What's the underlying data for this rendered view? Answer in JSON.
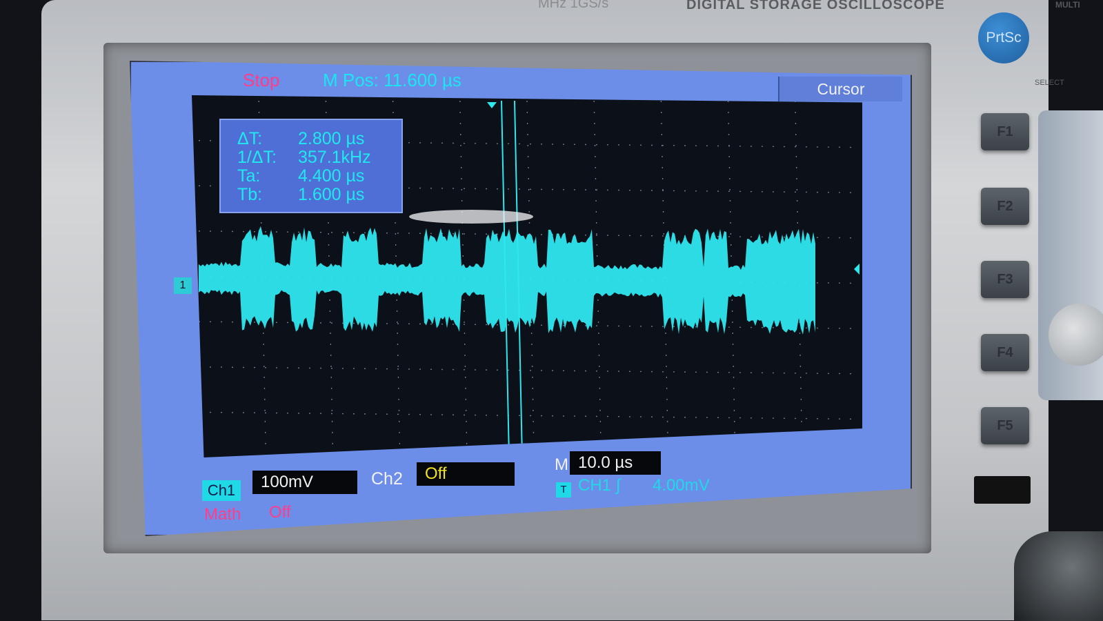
{
  "device": {
    "brand_label": "DIGITAL STORAGE OSCILLOSCOPE",
    "brand_partial": "MHz 1GS/s",
    "select_label": "SELECT",
    "multi_label": "MULTI",
    "prtsc_label": "PrtSc",
    "function_buttons": [
      "F1",
      "F2",
      "F3",
      "F4",
      "F5"
    ]
  },
  "screen": {
    "run_state": "Stop",
    "m_pos": "M Pos: 11.600 µs",
    "menu_title": "Cursor",
    "readout": [
      {
        "key": "ΔT:",
        "value": "2.800 µs"
      },
      {
        "key": "1/ΔT:",
        "value": "357.1kHz"
      },
      {
        "key": "Ta:",
        "value": "4.400 µs"
      },
      {
        "key": "Tb:",
        "value": "1.600 µs"
      }
    ],
    "ch1_label": "Ch1",
    "ch1_scale": "100mV",
    "ch2_label": "Ch2",
    "ch2_state": "Off",
    "math_label": "Math",
    "math_state": "Off",
    "timebase_prefix": "M",
    "timebase": "10.0 µs",
    "trigger_source": "CH1",
    "trigger_slope": "∫",
    "trigger_level": "4.00mV",
    "trigger_marker": "T",
    "ch1_marker": "1"
  },
  "colors": {
    "screen_bg": "#6d8ee8",
    "trace": "#2ee7ef",
    "stop": "#ff3d8a",
    "ch2_off": "#f3e21f"
  }
}
